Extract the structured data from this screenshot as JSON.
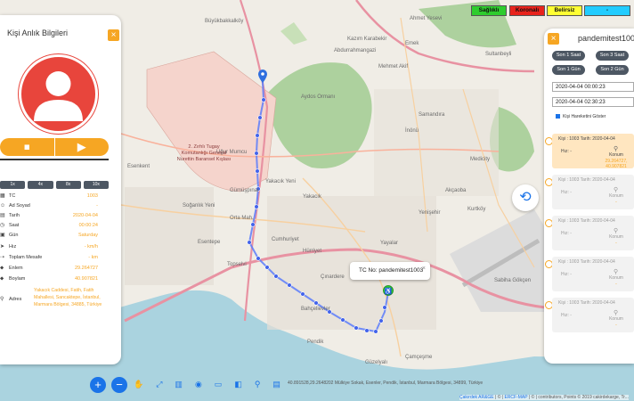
{
  "map_labels": {
    "buyukbakkalkoy": "Büyükbakkalköy",
    "ahmet_yesevi": "Ahmet Yesevi",
    "kazim_karabekir": "Kazım Karabekir",
    "abdurrahmangazi": "Abdurrahmangazi",
    "emek": "Emek",
    "sultanbeyli": "Sultanbeyli",
    "mehmet_akif": "Mehmet Akif",
    "aydos_ormani": "Aydos Ormanı",
    "samandira": "Samandıra",
    "inonu": "İnönü",
    "gurmumcu": "Uğur Mumcu",
    "yakacik_yeni": "Yakacık Yeni",
    "yakacik": "Yakacık",
    "gumuspinar": "Gümüşpınar",
    "soganlik": "Soğanlık Yeni",
    "orta_mah": "Orta Mah.",
    "esentepe": "Esentepe",
    "cumhuriyet": "Cumhuriyet",
    "huriyet": "Hürriyet",
    "yayalar": "Yayalar",
    "kurtkoy": "Kurtköy",
    "topselvi": "Topselvi",
    "cinardere": "Çınardere",
    "bahcelievler": "Bahçelievler",
    "pendik": "Pendik",
    "camcesme": "Çamçeşme",
    "esenkent": "Esenkent",
    "zirhli": "2. Zırhlı Tugay Komutanlığı General Nurettin Baransel Kışlası",
    "sabiha": "Sabiha Gökçen",
    "medicity": "Medicity",
    "akcaoba": "Akçaoba",
    "yenisehir": "Yenişehir",
    "guzelyali": "Güzelyalı"
  },
  "left_panel": {
    "title": "Kişi Anlık Bilgileri",
    "close": "×",
    "speeds": [
      "1x",
      "4x",
      "8x",
      "10x"
    ],
    "rows": [
      {
        "icon": "▦",
        "label": "TC",
        "value": "1003"
      },
      {
        "icon": "☺",
        "label": "Ad Soyad",
        "value": "-"
      },
      {
        "icon": "▤",
        "label": "Tarih",
        "value": "2020-04-04"
      },
      {
        "icon": "◷",
        "label": "Saat",
        "value": "00:00:24"
      },
      {
        "icon": "▣",
        "label": "Gün",
        "value": "Saturday"
      },
      {
        "icon": "➤",
        "label": "Hız",
        "value": "- km/h"
      },
      {
        "icon": "⇢",
        "label": "Toplam Mesafe",
        "value": "- km"
      },
      {
        "icon": "⬥",
        "label": "Enlem",
        "value": "29.264727"
      },
      {
        "icon": "⬥",
        "label": "Boylam",
        "value": "40.907821"
      }
    ],
    "address_label": "Adres",
    "address_value": "Yakacık Caddesi, Fatih, Fatih Mahallesi, Sancaktepe, İstanbul, Marmara Bölgesi, 34885, Türkiye"
  },
  "legend": {
    "healthy": "Sağlıklı",
    "corona": "Koronalı",
    "unknown": "Belirsiz",
    "other": "-"
  },
  "colors": {
    "accent": "#f6a623",
    "route": "#3b5bdb",
    "dark_button": "#4d5763",
    "blue": "#1a73e8",
    "healthy": "#2ecc2e",
    "corona": "#e8231c",
    "unknown": "#ffff33",
    "other": "#22ccff"
  },
  "right_panel": {
    "title": "pandemitest1003",
    "close": "×",
    "time_buttons": [
      "Son 1 Saat",
      "Son 3 Saat",
      "Son 1 Gün",
      "Son 2 Gün"
    ],
    "start_datetime": "2020-04-04 00:00:23",
    "end_datetime": "2020-04-04 02:30:23",
    "checkbox_label": "Kişi Hareketini Göster",
    "records": [
      {
        "head": "Kişi : 1003  Tarih: 2020-04-04",
        "speed": "Hız: -",
        "location_label": "Konum",
        "location": "29.264727, 40.907821",
        "active": true
      },
      {
        "head": "Kişi : 1003  Tarih: 2020-04-04",
        "speed": "Hız: -",
        "location_label": "Konum",
        "location": "-",
        "active": false
      },
      {
        "head": "Kişi : 1003  Tarih: 2020-04-04",
        "speed": "Hız: -",
        "location_label": "Konum",
        "location": "-",
        "active": false
      },
      {
        "head": "Kişi : 1003  Tarih: 2020-04-04",
        "speed": "Hız: -",
        "location_label": "Konum",
        "location": "-",
        "active": false
      },
      {
        "head": "Kişi : 1003  Tarih: 2020-04-04",
        "speed": "Hız: -",
        "location_label": "Konum",
        "location": "-",
        "active": false
      }
    ]
  },
  "popup": {
    "text": "TC No: pandemitest1003",
    "close": "×"
  },
  "bottom": {
    "zoom_in": "+",
    "zoom_out": "−",
    "tools": [
      "✋",
      "⤢",
      "▥",
      "◉",
      "▭",
      "◧",
      "⚲",
      "▤"
    ],
    "coords": "40.891528,29.2648202     Mülkiye Sokak, Esenler, Pendik, İstanbul, Marmara Bölgesi, 34899, Türkiye",
    "attribution_link": "Çakırdek AR&GE",
    "attribution_link2": "ERCF-MAP",
    "attribution_rest": "| © | contributors, Points © 2019 cakirdekarge, Tr..."
  }
}
